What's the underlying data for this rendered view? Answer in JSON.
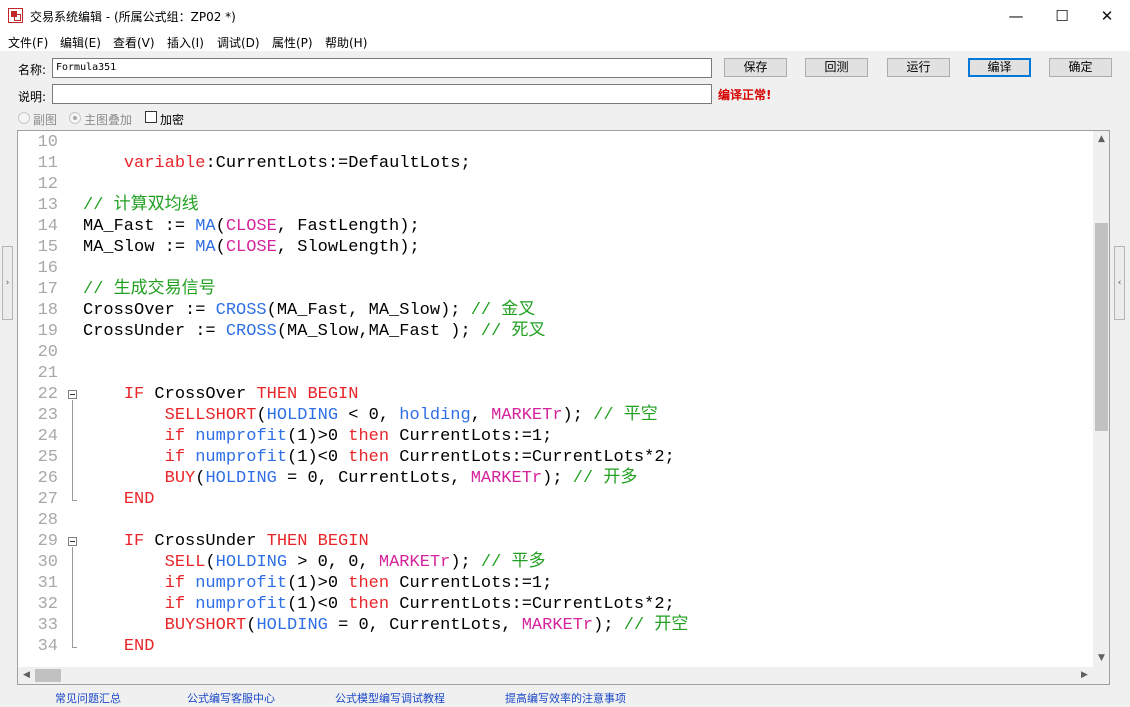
{
  "window": {
    "title": "交易系统编辑 - (所属公式组：ZP02 *)",
    "controls": {
      "minimize": "—",
      "maximize": "☐",
      "close": "✕"
    }
  },
  "menu": [
    "文件(F)",
    "编辑(E)",
    "查看(V)",
    "插入(I)",
    "调试(D)",
    "属性(P)",
    "帮助(H)"
  ],
  "form": {
    "name_label": "名称:",
    "name_value": "Formula351",
    "desc_label": "说明:",
    "desc_value": "",
    "status_text": "编译正常!",
    "buttons": {
      "save": "保存",
      "backtest": "回测",
      "run": "运行",
      "compile": "编译",
      "ok": "确定"
    },
    "options": {
      "sub_chart": "副图",
      "main_overlay": "主图叠加",
      "encrypt": "加密",
      "selected_option": "主图叠加",
      "encrypt_checked": false
    }
  },
  "editor": {
    "lines": [
      {
        "n": "10",
        "segs": []
      },
      {
        "n": "11",
        "segs": [
          {
            "t": "    "
          },
          {
            "t": "variable",
            "c": "red"
          },
          {
            "t": ":CurrentLots:=DefaultLots;"
          }
        ]
      },
      {
        "n": "12",
        "segs": []
      },
      {
        "n": "13",
        "segs": [
          {
            "t": "// 计算双均线",
            "c": "cmt"
          }
        ]
      },
      {
        "n": "14",
        "segs": [
          {
            "t": "MA_Fast := "
          },
          {
            "t": "MA",
            "c": "blue"
          },
          {
            "t": "("
          },
          {
            "t": "CLOSE",
            "c": "mag"
          },
          {
            "t": ", FastLength);"
          }
        ]
      },
      {
        "n": "15",
        "segs": [
          {
            "t": "MA_Slow := "
          },
          {
            "t": "MA",
            "c": "blue"
          },
          {
            "t": "("
          },
          {
            "t": "CLOSE",
            "c": "mag"
          },
          {
            "t": ", SlowLength);"
          }
        ]
      },
      {
        "n": "16",
        "segs": []
      },
      {
        "n": "17",
        "segs": [
          {
            "t": "// 生成交易信号",
            "c": "cmt"
          }
        ]
      },
      {
        "n": "18",
        "segs": [
          {
            "t": "CrossOver := "
          },
          {
            "t": "CROSS",
            "c": "blue"
          },
          {
            "t": "(MA_Fast, MA_Slow); "
          },
          {
            "t": "// 金叉",
            "c": "cmt"
          }
        ]
      },
      {
        "n": "19",
        "segs": [
          {
            "t": "CrossUnder := "
          },
          {
            "t": "CROSS",
            "c": "blue"
          },
          {
            "t": "(MA_Slow,MA_Fast ); "
          },
          {
            "t": "// 死叉",
            "c": "cmt"
          }
        ]
      },
      {
        "n": "20",
        "segs": []
      },
      {
        "n": "21",
        "segs": []
      },
      {
        "n": "22",
        "segs": [
          {
            "t": "    "
          },
          {
            "t": "IF",
            "c": "red"
          },
          {
            "t": " CrossOver "
          },
          {
            "t": "THEN BEGIN",
            "c": "red"
          }
        ]
      },
      {
        "n": "23",
        "segs": [
          {
            "t": "        "
          },
          {
            "t": "SELLSHORT",
            "c": "red"
          },
          {
            "t": "("
          },
          {
            "t": "HOLDING",
            "c": "blue"
          },
          {
            "t": " < 0, "
          },
          {
            "t": "holding",
            "c": "blue"
          },
          {
            "t": ", "
          },
          {
            "t": "MARKETr",
            "c": "mag"
          },
          {
            "t": "); "
          },
          {
            "t": "// 平空",
            "c": "cmt"
          }
        ]
      },
      {
        "n": "24",
        "segs": [
          {
            "t": "        "
          },
          {
            "t": "if",
            "c": "red"
          },
          {
            "t": " "
          },
          {
            "t": "numprofit",
            "c": "blue"
          },
          {
            "t": "(1)>0 "
          },
          {
            "t": "then",
            "c": "red"
          },
          {
            "t": " CurrentLots:=1;"
          }
        ]
      },
      {
        "n": "25",
        "segs": [
          {
            "t": "        "
          },
          {
            "t": "if",
            "c": "red"
          },
          {
            "t": " "
          },
          {
            "t": "numprofit",
            "c": "blue"
          },
          {
            "t": "(1)<0 "
          },
          {
            "t": "then",
            "c": "red"
          },
          {
            "t": " CurrentLots:=CurrentLots*2;"
          }
        ]
      },
      {
        "n": "26",
        "segs": [
          {
            "t": "        "
          },
          {
            "t": "BUY",
            "c": "red"
          },
          {
            "t": "("
          },
          {
            "t": "HOLDING",
            "c": "blue"
          },
          {
            "t": " = 0, CurrentLots, "
          },
          {
            "t": "MARKETr",
            "c": "mag"
          },
          {
            "t": "); "
          },
          {
            "t": "// 开多",
            "c": "cmt"
          }
        ]
      },
      {
        "n": "27",
        "segs": [
          {
            "t": "    "
          },
          {
            "t": "END",
            "c": "red"
          }
        ]
      },
      {
        "n": "28",
        "segs": []
      },
      {
        "n": "29",
        "segs": [
          {
            "t": "    "
          },
          {
            "t": "IF",
            "c": "red"
          },
          {
            "t": " CrossUnder "
          },
          {
            "t": "THEN BEGIN",
            "c": "red"
          }
        ]
      },
      {
        "n": "30",
        "segs": [
          {
            "t": "        "
          },
          {
            "t": "SELL",
            "c": "red"
          },
          {
            "t": "("
          },
          {
            "t": "HOLDING",
            "c": "blue"
          },
          {
            "t": " > 0, 0, "
          },
          {
            "t": "MARKETr",
            "c": "mag"
          },
          {
            "t": "); "
          },
          {
            "t": "// 平多",
            "c": "cmt"
          }
        ]
      },
      {
        "n": "31",
        "segs": [
          {
            "t": "        "
          },
          {
            "t": "if",
            "c": "red"
          },
          {
            "t": " "
          },
          {
            "t": "numprofit",
            "c": "blue"
          },
          {
            "t": "(1)>0 "
          },
          {
            "t": "then",
            "c": "red"
          },
          {
            "t": " CurrentLots:=1;"
          }
        ]
      },
      {
        "n": "32",
        "segs": [
          {
            "t": "        "
          },
          {
            "t": "if",
            "c": "red"
          },
          {
            "t": " "
          },
          {
            "t": "numprofit",
            "c": "blue"
          },
          {
            "t": "(1)<0 "
          },
          {
            "t": "then",
            "c": "red"
          },
          {
            "t": " CurrentLots:=CurrentLots*2;"
          }
        ]
      },
      {
        "n": "33",
        "segs": [
          {
            "t": "        "
          },
          {
            "t": "BUYSHORT",
            "c": "red"
          },
          {
            "t": "("
          },
          {
            "t": "HOLDING",
            "c": "blue"
          },
          {
            "t": " = 0, CurrentLots, "
          },
          {
            "t": "MARKETr",
            "c": "mag"
          },
          {
            "t": "); "
          },
          {
            "t": "// 开空",
            "c": "cmt"
          }
        ]
      },
      {
        "n": "34",
        "segs": [
          {
            "t": "    "
          },
          {
            "t": "END",
            "c": "red"
          }
        ]
      }
    ]
  },
  "scroll_arrows": {
    "up": "▲",
    "down": "▼",
    "left": "◀",
    "right": "▶"
  },
  "side_tabs": {
    "left": "›",
    "right": "‹"
  },
  "footer_links": [
    "常见问题汇总",
    "公式编写客服中心",
    "公式模型编写调试教程",
    "提高编写效率的注意事项"
  ],
  "colors": {
    "keyword_red": "#e8262a",
    "keyword_blue": "#2f6fe6",
    "keyword_magenta": "#d6249c",
    "comment_green": "#22a022",
    "line_number": "#a8a8a8",
    "status_red": "#d60000",
    "link_blue": "#1a47c8",
    "focus_blue": "#0078d7"
  }
}
